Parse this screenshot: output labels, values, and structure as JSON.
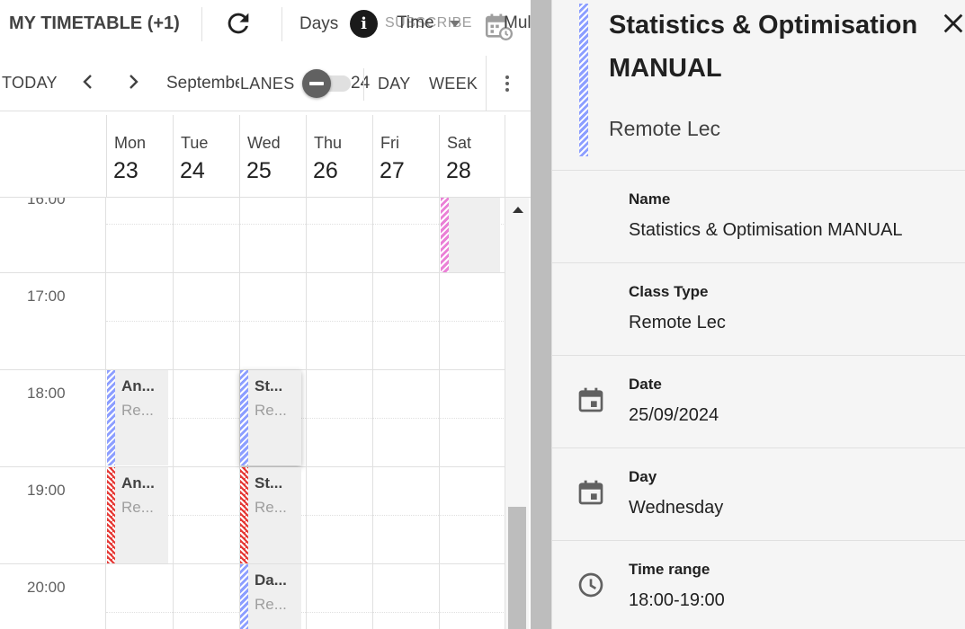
{
  "topbar": {
    "title": "MY TIMETABLE (+1)",
    "days_label": "Days",
    "info_glyph": "i",
    "subscribe_label": "SUBSCRIBE",
    "time_label": "Time",
    "multi_label": "Mul"
  },
  "nav": {
    "today_label": "TODAY",
    "month_label": "September",
    "lanes_label": "LANES",
    "lanes_toggle": "off",
    "year_fragment": "24",
    "day_label": "DAY",
    "week_label": "WEEK"
  },
  "days": [
    {
      "name": "Mon",
      "num": "23"
    },
    {
      "name": "Tue",
      "num": "24"
    },
    {
      "name": "Wed",
      "num": "25"
    },
    {
      "name": "Thu",
      "num": "26"
    },
    {
      "name": "Fri",
      "num": "27"
    },
    {
      "name": "Sat",
      "num": "28"
    }
  ],
  "times": [
    "16:00",
    "17:00",
    "18:00",
    "19:00",
    "20:00"
  ],
  "events": [
    {
      "title": "An...",
      "sub": "Re...",
      "color": "#8c9eff"
    },
    {
      "title": "An...",
      "sub": "Re...",
      "color": "#e53935"
    },
    {
      "title": "St...",
      "sub": "Re...",
      "color": "#8c9eff"
    },
    {
      "title": "St...",
      "sub": "Re...",
      "color": "#e53935"
    },
    {
      "title": "Da...",
      "sub": "Re...",
      "color": "#8c9eff"
    },
    {
      "title": "",
      "sub": "",
      "color": "#ea80d6"
    }
  ],
  "panel": {
    "title": "Statistics & Optimisation MANUAL",
    "subtitle": "Remote Lec",
    "name_label": "Name",
    "name_value": "Statistics & Optimisation MANUAL",
    "class_type_label": "Class Type",
    "class_type_value": "Remote Lec",
    "date_label": "Date",
    "date_value": "25/09/2024",
    "day_label": "Day",
    "day_value": "Wednesday",
    "time_range_label": "Time range",
    "time_range_value": "18:00-19:00"
  },
  "icons": {
    "refresh": "refresh-icon",
    "info": "info-icon",
    "calendar_sync": "calendar-sync-icon",
    "prev": "chevron-left-icon",
    "next": "chevron-right-icon",
    "more": "more-vert-icon",
    "close": "close-icon",
    "date": "calendar-icon",
    "time": "clock-icon"
  },
  "colors": {
    "event_blue": "#8c9eff",
    "event_red": "#e53935",
    "event_pink": "#ea80d6",
    "event_bg": "#efefef"
  }
}
